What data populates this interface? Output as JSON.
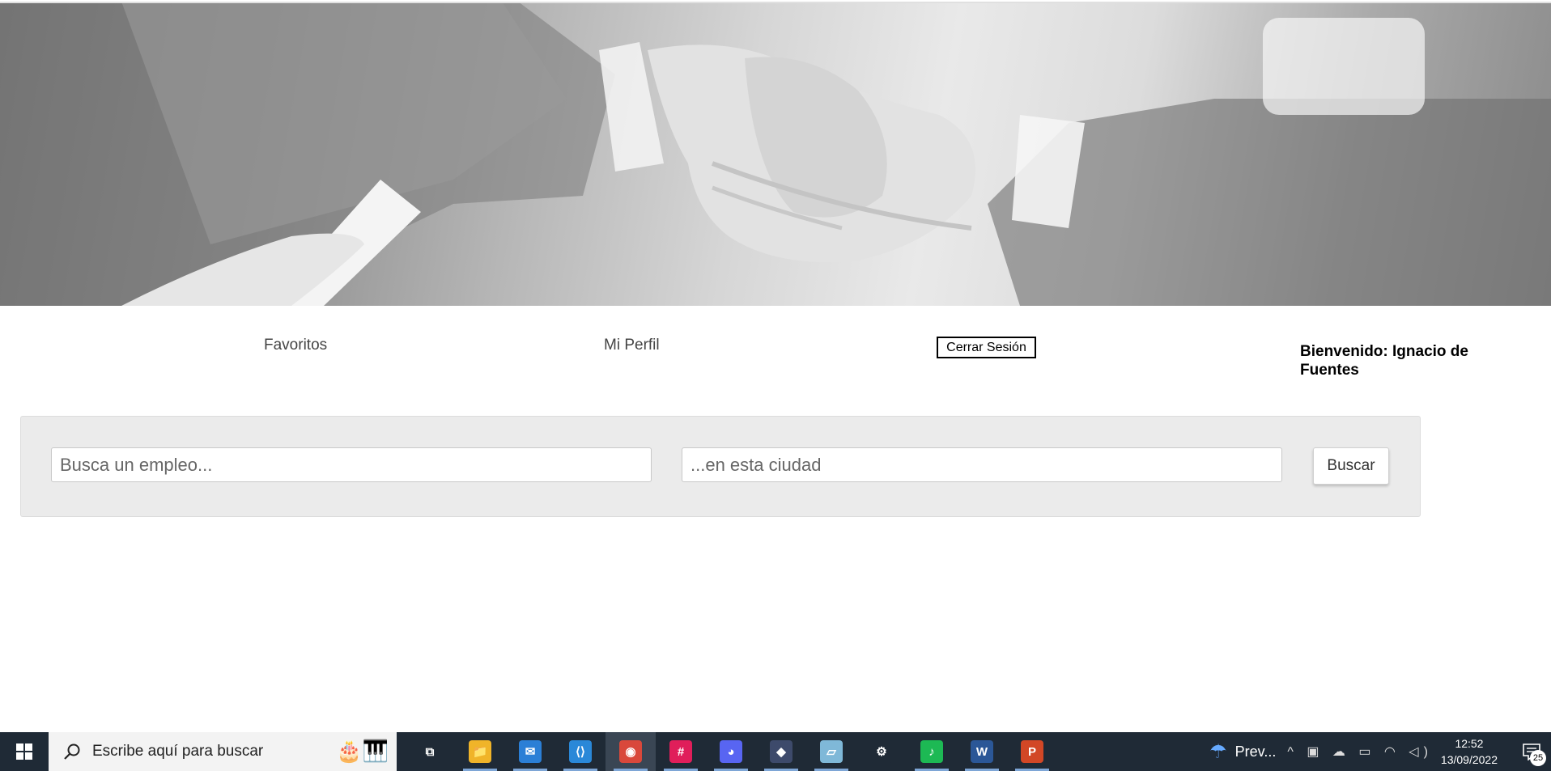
{
  "nav": {
    "favorites_label": "Favoritos",
    "profile_label": "Mi Perfil",
    "logout_label": "Cerrar Sesión",
    "welcome_text": "Bienvenido: Ignacio de Fuentes"
  },
  "search": {
    "job_placeholder": "Busca un empleo...",
    "city_placeholder": "...en esta ciudad",
    "button_label": "Buscar"
  },
  "taskbar": {
    "search_placeholder": "Escribe aquí para buscar",
    "apps": [
      {
        "name": "task-view-icon",
        "label": "⧉",
        "color": "#1f2a36"
      },
      {
        "name": "file-explorer-icon",
        "label": "📁",
        "color": "#f0b429"
      },
      {
        "name": "mail-icon",
        "label": "✉",
        "color": "#2b7fd6"
      },
      {
        "name": "vscode-icon",
        "label": "⟨⟩",
        "color": "#2a88d8"
      },
      {
        "name": "chrome-icon",
        "label": "◉",
        "color": "#d9483b"
      },
      {
        "name": "slack-icon",
        "label": "#",
        "color": "#e01e5a"
      },
      {
        "name": "discord-icon",
        "label": "◕",
        "color": "#5865f2"
      },
      {
        "name": "app-icon",
        "label": "◆",
        "color": "#3d4a6b"
      },
      {
        "name": "notes-icon",
        "label": "▱",
        "color": "#7fb8d8"
      },
      {
        "name": "settings-icon",
        "label": "⚙",
        "color": "#1f2a36"
      },
      {
        "name": "spotify-icon",
        "label": "♪",
        "color": "#1db954"
      },
      {
        "name": "word-icon",
        "label": "W",
        "color": "#2b5797"
      },
      {
        "name": "powerpoint-icon",
        "label": "P",
        "color": "#d24726"
      }
    ],
    "weather_label": "Prev...",
    "time": "12:52",
    "date": "13/09/2022",
    "notification_count": "25"
  }
}
